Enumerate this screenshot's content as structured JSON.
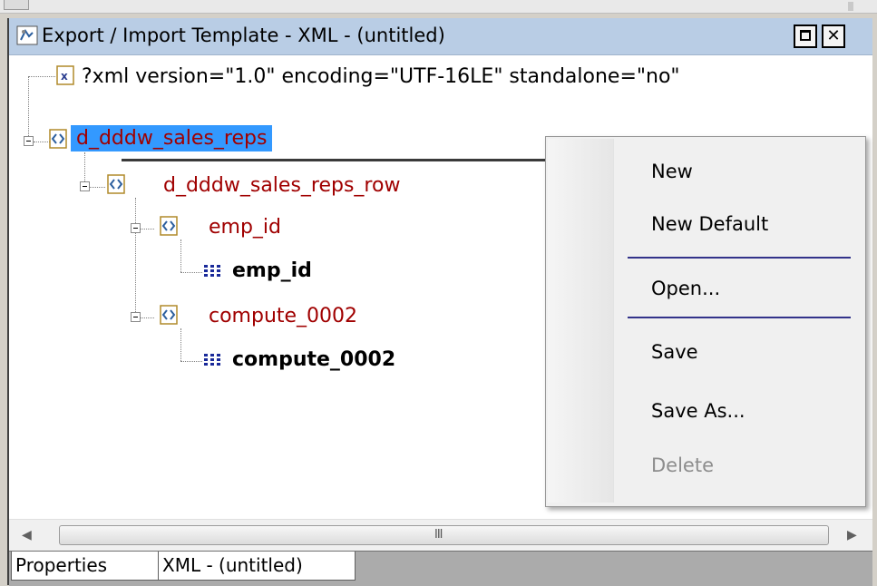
{
  "window": {
    "title": "Export / Import Template - XML - (untitled)"
  },
  "tree": {
    "xml_declaration": "?xml version=\"1.0\" encoding=\"UTF-16LE\" standalone=\"no\"",
    "root": "d_dddw_sales_reps",
    "row_element": "d_dddw_sales_reps_row",
    "child1_element": "emp_id",
    "child1_column": "emp_id",
    "child2_element": "compute_0002",
    "child2_column": "compute_0002"
  },
  "context_menu": {
    "items": [
      "New",
      "New Default",
      "Open...",
      "Save",
      "Save As...",
      "Delete"
    ]
  },
  "tabs": [
    "Properties",
    "XML - (untitled)"
  ],
  "scrollbar": {
    "grip": "III"
  },
  "colors": {
    "selection": "#3399ff",
    "element_text": "#a00000",
    "titlebar": "#b9cde5"
  }
}
